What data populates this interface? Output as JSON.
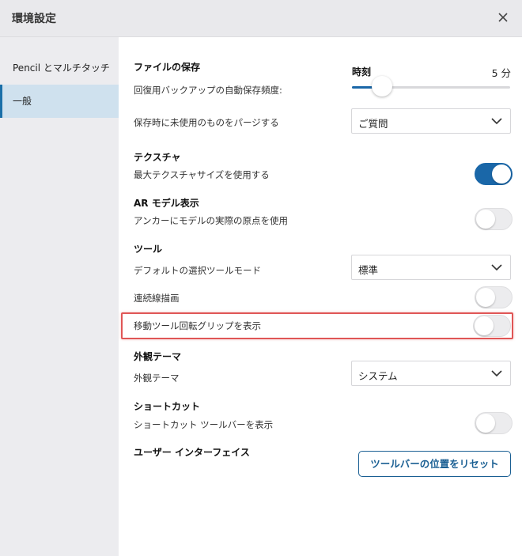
{
  "window": {
    "title": "環境設定"
  },
  "sidebar": {
    "items": [
      {
        "label": "Pencil とマルチタッチ"
      },
      {
        "label": "一般"
      }
    ]
  },
  "file_save": {
    "heading": "ファイルの保存",
    "slider_title": "時刻",
    "slider_value": "5 分",
    "autosave_label": "回復用バックアップの自動保存頻度:",
    "purge_label": "保存時に未使用のものをパージする",
    "purge_value": "ご質問"
  },
  "textures": {
    "heading": "テクスチャ",
    "max_label": "最大テクスチャサイズを使用する",
    "max_on": true
  },
  "ar": {
    "heading": "AR モデル表示",
    "anchor_label": "アンカーにモデルの実際の原点を使用",
    "anchor_on": false
  },
  "tools": {
    "heading": "ツール",
    "default_mode_label": "デフォルトの選択ツールモード",
    "default_mode_value": "標準",
    "continuous_label": "連続線描画",
    "continuous_on": false,
    "rotate_grip_label": "移動ツール回転グリップを表示",
    "rotate_grip_on": false
  },
  "appearance": {
    "heading": "外観テーマ",
    "theme_label": "外観テーマ",
    "theme_value": "システム"
  },
  "shortcuts": {
    "heading": "ショートカット",
    "toolbar_label": "ショートカット ツールバーを表示",
    "toolbar_on": false
  },
  "ui": {
    "heading": "ユーザー インターフェイス",
    "reset_button": "ツールバーの位置をリセット"
  },
  "colors": {
    "accent": "#1a67a8",
    "highlight": "#e05656"
  },
  "autosave_fraction": 0.19
}
